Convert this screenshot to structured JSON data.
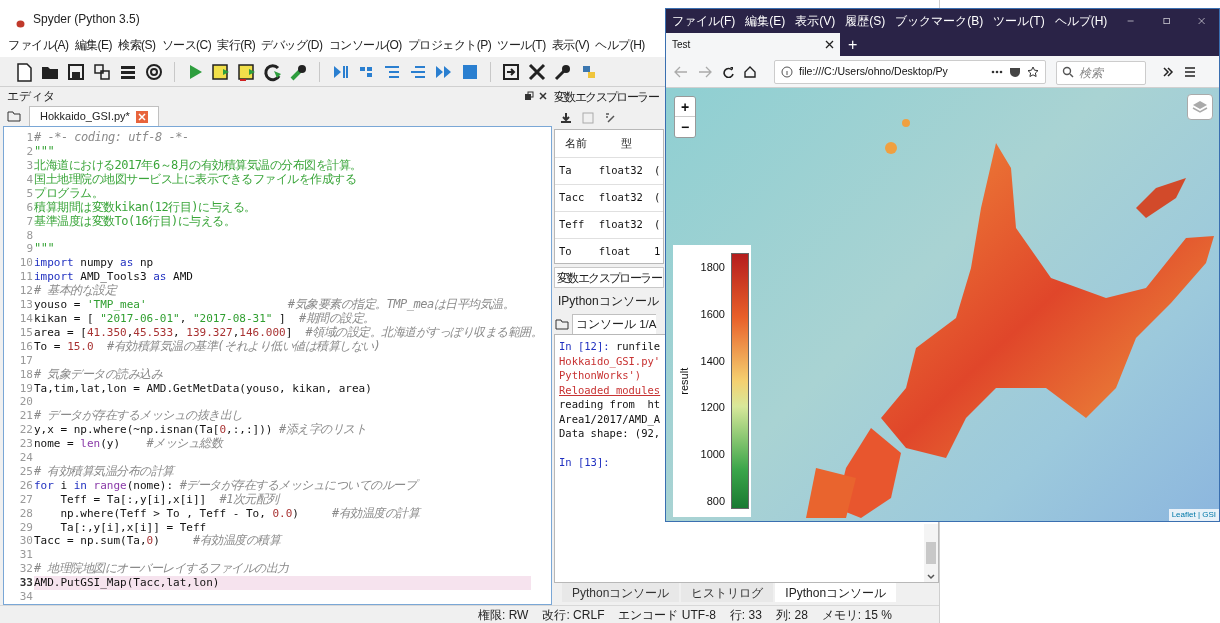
{
  "spyder": {
    "title": "Spyder (Python 3.5)",
    "menu": [
      "ファイル(A)",
      "編集(E)",
      "検索(S)",
      "ソース(C)",
      "実行(R)",
      "デバッグ(D)",
      "コンソール(O)",
      "プロジェクト(P)",
      "ツール(T)",
      "表示(V)",
      "ヘルプ(H)"
    ],
    "editor": {
      "pane_title": "エディタ",
      "tabs": [
        {
          "label": "Hokkaido_GSI.py*",
          "selected": true
        }
      ],
      "lines": [
        {
          "no": "1",
          "current": false,
          "segments": [
            {
              "kind": "comment",
              "text": "# -*- coding: utf-8 -*-"
            }
          ]
        },
        {
          "no": "2",
          "current": false,
          "segments": [
            {
              "kind": "doc",
              "text": "\"\"\""
            }
          ]
        },
        {
          "no": "3",
          "current": false,
          "segments": [
            {
              "kind": "doc",
              "text": "北海道における2017年6～8月の有効積算気温の分布図を計算。"
            }
          ]
        },
        {
          "no": "4",
          "current": false,
          "segments": [
            {
              "kind": "doc",
              "text": "国土地理院の地図サービス上に表示できるファイルを作成する"
            }
          ]
        },
        {
          "no": "5",
          "current": false,
          "segments": [
            {
              "kind": "doc",
              "text": "プログラム。"
            }
          ]
        },
        {
          "no": "6",
          "current": false,
          "segments": [
            {
              "kind": "doc",
              "text": "積算期間は変数kikan(12行目)に与える。"
            }
          ]
        },
        {
          "no": "7",
          "current": false,
          "segments": [
            {
              "kind": "doc",
              "text": "基準温度は変数To(16行目)に与える。"
            }
          ]
        },
        {
          "no": "8",
          "current": false
        },
        {
          "no": "9",
          "current": false,
          "segments": [
            {
              "kind": "doc",
              "text": "\"\"\""
            }
          ]
        },
        {
          "no": "10",
          "current": false,
          "segments": [
            {
              "kind": "keyword",
              "text": "import"
            },
            {
              "kind": "code",
              "text": " numpy "
            },
            {
              "kind": "keyword",
              "text": "as"
            },
            {
              "kind": "code",
              "text": " np"
            }
          ]
        },
        {
          "no": "11",
          "current": false,
          "segments": [
            {
              "kind": "keyword",
              "text": "import"
            },
            {
              "kind": "code",
              "text": " AMD_Tools3 "
            },
            {
              "kind": "keyword",
              "text": "as"
            },
            {
              "kind": "code",
              "text": " AMD"
            }
          ]
        },
        {
          "no": "12",
          "current": false,
          "segments": [
            {
              "kind": "comment",
              "text": "# 基本的な設定"
            }
          ]
        },
        {
          "no": "13",
          "current": false,
          "segments": [
            {
              "kind": "code",
              "text": "youso = "
            },
            {
              "kind": "string",
              "text": "'TMP_mea'"
            },
            {
              "kind": "comment",
              "text": "                     #気象要素の指定。TMP_meaは日平均気温。"
            }
          ]
        },
        {
          "no": "14",
          "current": false,
          "segments": [
            {
              "kind": "code",
              "text": "kikan = [ "
            },
            {
              "kind": "string",
              "text": "\"2017-06-01\""
            },
            {
              "kind": "code",
              "text": ", "
            },
            {
              "kind": "string",
              "text": "\"2017-08-31\""
            },
            {
              "kind": "code",
              "text": " ]  "
            },
            {
              "kind": "comment",
              "text": "#期間の設定。"
            }
          ]
        },
        {
          "no": "15",
          "current": false,
          "segments": [
            {
              "kind": "code",
              "text": "area = ["
            },
            {
              "kind": "number",
              "text": "41.350"
            },
            {
              "kind": "code",
              "text": ","
            },
            {
              "kind": "number",
              "text": "45.533"
            },
            {
              "kind": "code",
              "text": ", "
            },
            {
              "kind": "number",
              "text": "139.327"
            },
            {
              "kind": "code",
              "text": ","
            },
            {
              "kind": "number",
              "text": "146.000"
            },
            {
              "kind": "code",
              "text": "]  "
            },
            {
              "kind": "comment",
              "text": "#領域の設定。北海道がすっぽり収まる範囲。"
            }
          ]
        },
        {
          "no": "16",
          "current": false,
          "segments": [
            {
              "kind": "code",
              "text": "To = "
            },
            {
              "kind": "number",
              "text": "15.0"
            },
            {
              "kind": "comment",
              "text": "  #有効積算気温の基準(それより低い値は積算しない)"
            }
          ]
        },
        {
          "no": "17",
          "current": false
        },
        {
          "no": "18",
          "current": false,
          "segments": [
            {
              "kind": "comment",
              "text": "# 気象データの読み込み"
            }
          ]
        },
        {
          "no": "19",
          "current": false,
          "segments": [
            {
              "kind": "code",
              "text": "Ta,tim,lat,lon = AMD.GetMetData(youso, kikan, area)"
            }
          ]
        },
        {
          "no": "20",
          "current": false
        },
        {
          "no": "21",
          "current": false,
          "segments": [
            {
              "kind": "comment",
              "text": "# データが存在するメッシュの抜き出し"
            }
          ]
        },
        {
          "no": "22",
          "current": false,
          "segments": [
            {
              "kind": "code",
              "text": "y,x = np.where(~np.isnan(Ta["
            },
            {
              "kind": "number",
              "text": "0"
            },
            {
              "kind": "code",
              "text": ",:,:])) "
            },
            {
              "kind": "comment",
              "text": "#添え字のリスト"
            }
          ]
        },
        {
          "no": "23",
          "current": false,
          "segments": [
            {
              "kind": "code",
              "text": "nome = "
            },
            {
              "kind": "builtin",
              "text": "len"
            },
            {
              "kind": "code",
              "text": "(y)    "
            },
            {
              "kind": "comment",
              "text": "#メッシュ総数"
            }
          ]
        },
        {
          "no": "24",
          "current": false
        },
        {
          "no": "25",
          "current": false,
          "segments": [
            {
              "kind": "comment",
              "text": "# 有効積算気温分布の計算"
            }
          ]
        },
        {
          "no": "26",
          "current": false,
          "segments": [
            {
              "kind": "keyword",
              "text": "for"
            },
            {
              "kind": "code",
              "text": " i "
            },
            {
              "kind": "keyword",
              "text": "in"
            },
            {
              "kind": "builtin",
              "text": " range"
            },
            {
              "kind": "code",
              "text": "(nome): "
            },
            {
              "kind": "comment",
              "text": "#データが存在するメッシュについてのループ"
            }
          ]
        },
        {
          "no": "27",
          "current": false,
          "segments": [
            {
              "kind": "code",
              "text": "    Teff = Ta[:,y[i],x[i]]  "
            },
            {
              "kind": "comment",
              "text": "#1次元配列"
            }
          ]
        },
        {
          "no": "28",
          "current": false,
          "segments": [
            {
              "kind": "code",
              "text": "    np.where(Teff > To , Teff - To, "
            },
            {
              "kind": "number",
              "text": "0.0"
            },
            {
              "kind": "code",
              "text": ")     "
            },
            {
              "kind": "comment",
              "text": "#有効温度の計算"
            }
          ]
        },
        {
          "no": "29",
          "current": false,
          "segments": [
            {
              "kind": "code",
              "text": "    Ta[:,y[i],x[i]] = Teff"
            }
          ]
        },
        {
          "no": "30",
          "current": false,
          "segments": [
            {
              "kind": "code",
              "text": "Tacc = np.sum(Ta,"
            },
            {
              "kind": "number",
              "text": "0"
            },
            {
              "kind": "code",
              "text": ")     "
            },
            {
              "kind": "comment",
              "text": "#有効温度の積算"
            }
          ]
        },
        {
          "no": "31",
          "current": false
        },
        {
          "no": "32",
          "current": false,
          "segments": [
            {
              "kind": "comment",
              "text": "# 地理院地図にオーバーレイするファイルの出力"
            }
          ]
        },
        {
          "no": "33",
          "current": true,
          "segments": [
            {
              "kind": "code",
              "text": "AMD.PutGSI_Map(Tacc,lat,lon)"
            }
          ]
        },
        {
          "no": "34",
          "current": false
        }
      ]
    },
    "variable_explorer": {
      "pane_title": "変数エクスプローラー",
      "columns": [
        "名前",
        "型"
      ],
      "rows": [
        {
          "name": "Ta",
          "type": "float32",
          "column_3": "("
        },
        {
          "name": "Tacc",
          "type": "float32",
          "column_3": "("
        },
        {
          "name": "Teff",
          "type": "float32",
          "column_3": "("
        },
        {
          "name": "To",
          "type": "float",
          "column_3": "1"
        }
      ],
      "tabs": [
        {
          "label": "変数エクスプローラー",
          "selected": true
        }
      ]
    },
    "console": {
      "pane_title": "IPythonコンソール",
      "tabs": [
        {
          "label": "コンソール 1/A",
          "selected": true
        }
      ],
      "lines": [
        {
          "segments": [
            {
              "kind": "prompt",
              "text": "In [12]:"
            },
            {
              "kind": "out",
              "text": " runfile"
            }
          ]
        },
        {
          "segments": [
            {
              "kind": "error",
              "text": "Hokkaido_GSI.py'"
            }
          ]
        },
        {
          "segments": [
            {
              "kind": "error",
              "text": "PythonWorks')"
            }
          ]
        },
        {
          "segments": [
            {
              "kind": "link",
              "text": "Reloaded modules"
            }
          ]
        },
        {
          "segments": [
            {
              "kind": "out",
              "text": "reading from  ht"
            }
          ]
        },
        {
          "segments": [
            {
              "kind": "out",
              "text": "Area1/2017/AMD_A"
            }
          ]
        },
        {
          "segments": [
            {
              "kind": "out",
              "text": "Data shape: (92,"
            }
          ]
        }
      ],
      "input_prompt": {
        "segments": [
          {
            "kind": "prompt",
            "text": "In [13]:"
          }
        ]
      },
      "bottom_tabs": [
        {
          "label": "Pythonコンソール",
          "selected": false
        },
        {
          "label": "ヒストリログ",
          "selected": false
        },
        {
          "label": "IPythonコンソール",
          "selected": true
        }
      ]
    },
    "status_bar": [
      "権限: RW",
      "改行: CRLF",
      "エンコード UTF-8",
      "行: 33",
      "列: 28",
      "メモリ: 15 %"
    ]
  },
  "browser": {
    "menu": [
      "ファイル(F)",
      "編集(E)",
      "表示(V)",
      "履歴(S)",
      "ブックマーク(B)",
      "ツール(T)",
      "ヘルプ(H)"
    ],
    "tabs": [
      {
        "label": "Test",
        "selected": true
      }
    ],
    "new_tab": "+",
    "url": "file:///C:/Users/ohno/Desktop/Py",
    "search": {
      "placeholder": "検索"
    },
    "map": {
      "zoom_in": "+",
      "zoom_out": "−",
      "legend": {
        "title": "result",
        "ticks": [
          "1800",
          "1600",
          "1400",
          "1200",
          "1000",
          "800"
        ]
      },
      "attribution": "Leaflet | GSI"
    }
  }
}
